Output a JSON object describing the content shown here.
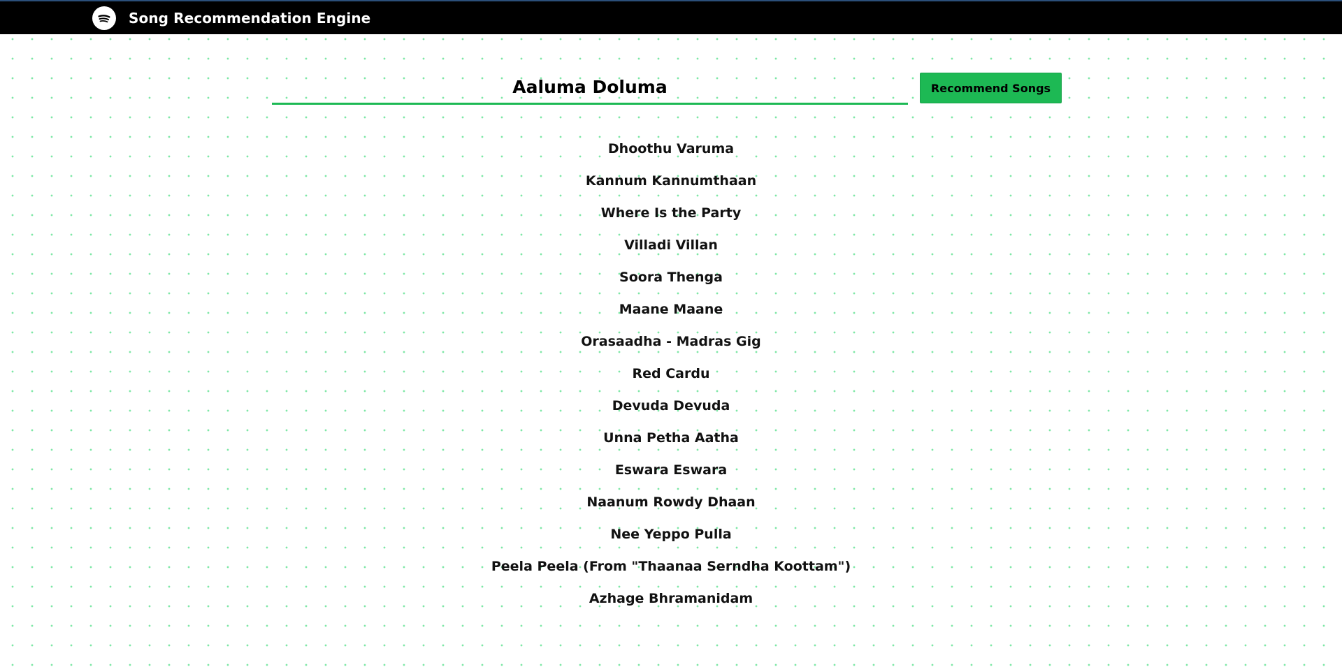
{
  "header": {
    "title": "Song Recommendation Engine",
    "logo_icon": "spotify-logo-icon",
    "background": "#000000"
  },
  "search": {
    "value": "Aaluma Doluma",
    "placeholder": ""
  },
  "recommend_button": {
    "label": "Recommend Songs",
    "color": "#1db954"
  },
  "recommendations": [
    "Dhoothu Varuma",
    "Kannum Kannumthaan",
    "Where Is the Party",
    "Villadi Villan",
    "Soora Thenga",
    "Maane Maane",
    "Orasaadha - Madras Gig",
    "Red Cardu",
    "Devuda Devuda",
    "Unna Petha Aatha",
    "Eswara Eswara",
    "Naanum Rowdy Dhaan",
    "Nee Yeppo Pulla",
    "Peela Peela (From \"Thaanaa Serndha Koottam\")",
    "Azhage Bhramanidam"
  ]
}
